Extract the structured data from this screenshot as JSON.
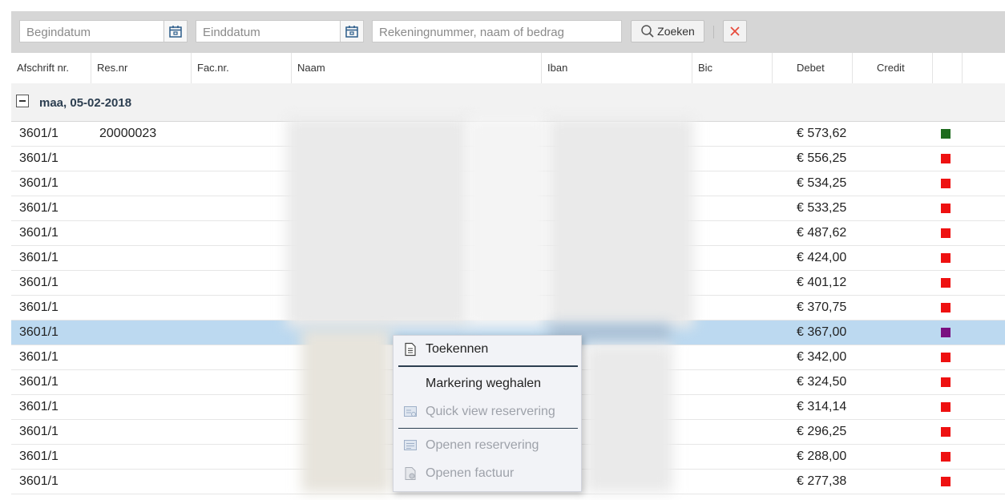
{
  "toolbar": {
    "begin_placeholder": "Begindatum",
    "end_placeholder": "Einddatum",
    "search_placeholder": "Rekeningnummer, naam of bedrag",
    "search_label": "Zoeken",
    "clear_icon": "close-icon"
  },
  "columns": [
    "Afschrift nr.",
    "Res.nr",
    "Fac.nr.",
    "Naam",
    "Iban",
    "Bic",
    "Debet",
    "Credit"
  ],
  "group": {
    "label": "maa, 05-02-2018"
  },
  "rows": [
    {
      "afschrift": "3601/1",
      "resnr": "20000023",
      "debet": "€ 573,62",
      "marker": "#1e6b1e"
    },
    {
      "afschrift": "3601/1",
      "resnr": "",
      "debet": "€ 556,25",
      "marker": "#ee1111"
    },
    {
      "afschrift": "3601/1",
      "resnr": "",
      "debet": "€ 534,25",
      "marker": "#ee1111"
    },
    {
      "afschrift": "3601/1",
      "resnr": "",
      "debet": "€ 533,25",
      "marker": "#ee1111"
    },
    {
      "afschrift": "3601/1",
      "resnr": "",
      "debet": "€ 487,62",
      "marker": "#ee1111"
    },
    {
      "afschrift": "3601/1",
      "resnr": "",
      "debet": "€ 424,00",
      "marker": "#ee1111"
    },
    {
      "afschrift": "3601/1",
      "resnr": "",
      "debet": "€ 401,12",
      "marker": "#ee1111"
    },
    {
      "afschrift": "3601/1",
      "resnr": "",
      "debet": "€ 370,75",
      "marker": "#ee1111"
    },
    {
      "afschrift": "3601/1",
      "resnr": "",
      "debet": "€ 367,00",
      "marker": "#7a1080",
      "selected": true
    },
    {
      "afschrift": "3601/1",
      "resnr": "",
      "debet": "€ 342,00",
      "marker": "#ee1111"
    },
    {
      "afschrift": "3601/1",
      "resnr": "",
      "debet": "€ 324,50",
      "marker": "#ee1111"
    },
    {
      "afschrift": "3601/1",
      "resnr": "",
      "debet": "€ 314,14",
      "marker": "#ee1111"
    },
    {
      "afschrift": "3601/1",
      "resnr": "",
      "debet": "€ 296,25",
      "marker": "#ee1111"
    },
    {
      "afschrift": "3601/1",
      "resnr": "",
      "debet": "€ 288,00",
      "marker": "#ee1111"
    },
    {
      "afschrift": "3601/1",
      "resnr": "",
      "debet": "€ 277,38",
      "marker": "#ee1111"
    }
  ],
  "context_menu": {
    "items": [
      {
        "label": "Toekennen",
        "icon": "document-icon",
        "enabled": true
      },
      {
        "label": "Markering weghalen",
        "icon": "",
        "enabled": true
      },
      {
        "label": "Quick view reservering",
        "icon": "quick-view-icon",
        "enabled": false
      },
      {
        "label": "Openen reservering",
        "icon": "reservation-icon",
        "enabled": false
      },
      {
        "label": "Openen factuur",
        "icon": "invoice-icon",
        "enabled": false
      }
    ]
  },
  "colors": {
    "selected_row": "#bcd9f0",
    "group_label": "#2c3e50",
    "clear_icon": "#e74c3c"
  }
}
